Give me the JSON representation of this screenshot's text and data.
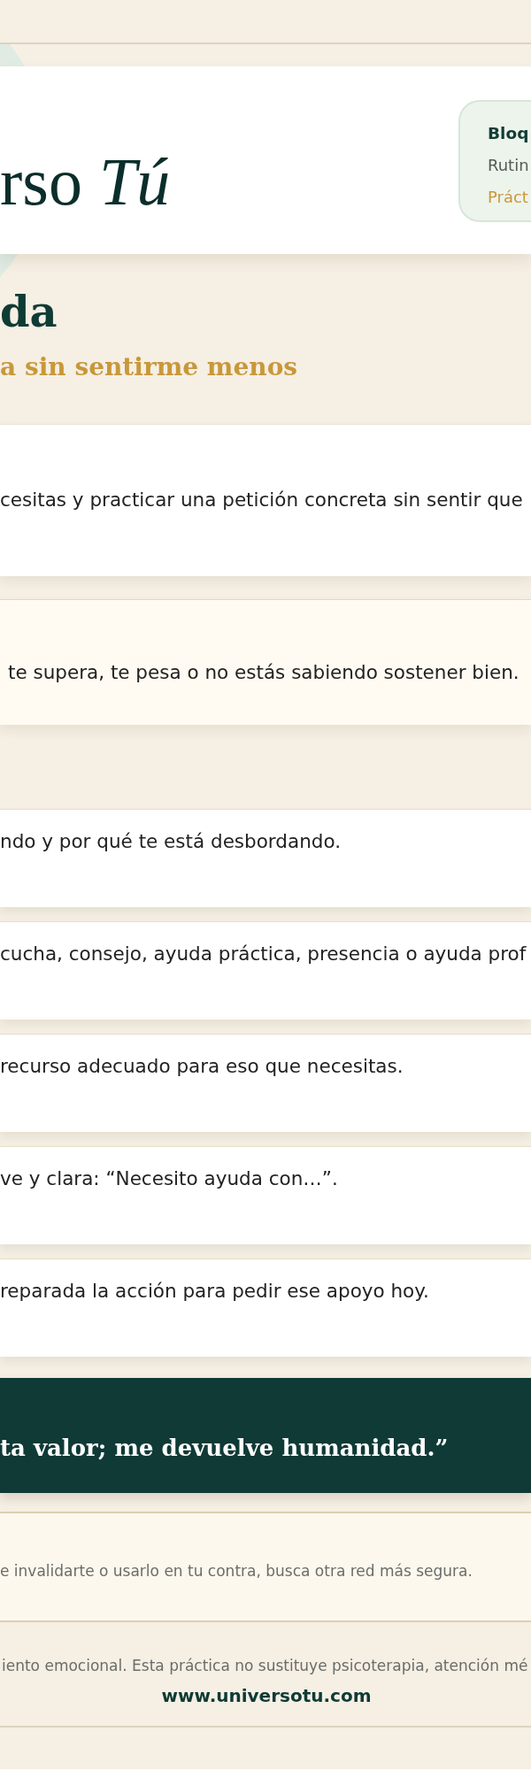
{
  "header": {
    "logo": "rso *Tú*",
    "badge": {
      "title": "Bloq",
      "line_1": "Rutin",
      "line_2": "Práct"
    }
  },
  "title": "da",
  "subtitle": "a sin sentirme menos",
  "intro": {
    "text": "cesitas y practicar una petición concreta sin sentir que"
  },
  "warning": {
    "text": "te supera, te pesa o no estás sabiendo sostener bien."
  },
  "steps": [
    {
      "text": "ndo y por qué te está desbordando."
    },
    {
      "text": "cucha, consejo, ayuda práctica, presencia o ayuda prof"
    },
    {
      "text": "recurso adecuado para eso que necesitas."
    },
    {
      "text": "ve y clara: “Necesito ayuda con…”."
    },
    {
      "text": "reparada la acción para pedir ese apoyo hoy."
    }
  ],
  "quote": "ta valor; me devuelve humanidad.”",
  "safety_note": "e invalidarte o usarlo en tu contra, busca otra red más segura.",
  "footer": {
    "disclaimer": "iento emocional. Esta práctica no sustituye psicoterapia, atención mé",
    "url": "www.universotu.com"
  }
}
